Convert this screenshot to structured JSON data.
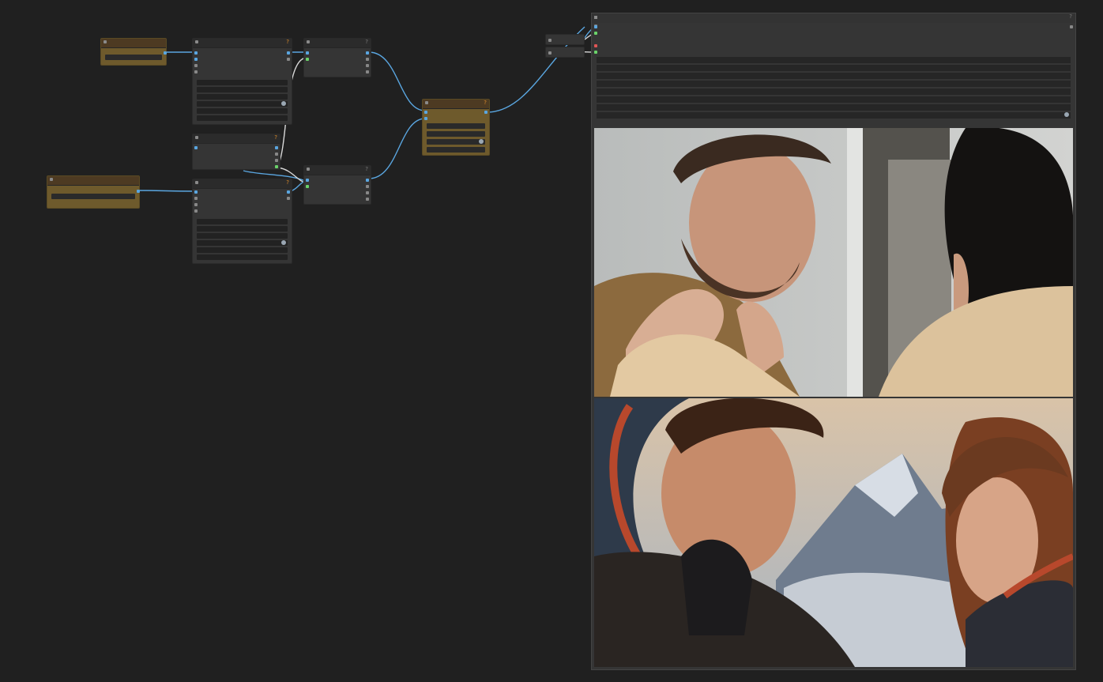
{
  "app": {
    "name": "node-graph-editor"
  },
  "nodes": {
    "badge_symbol": "?",
    "colors": {
      "default": "#353535",
      "gold": "#6e5a2c",
      "link": "#5aa6e0",
      "link_white": "#d8d8d8"
    }
  },
  "preview": {
    "images": [
      {
        "subject": "couple-indoor-photo"
      },
      {
        "subject": "astronauts-mountains-photo"
      }
    ]
  }
}
